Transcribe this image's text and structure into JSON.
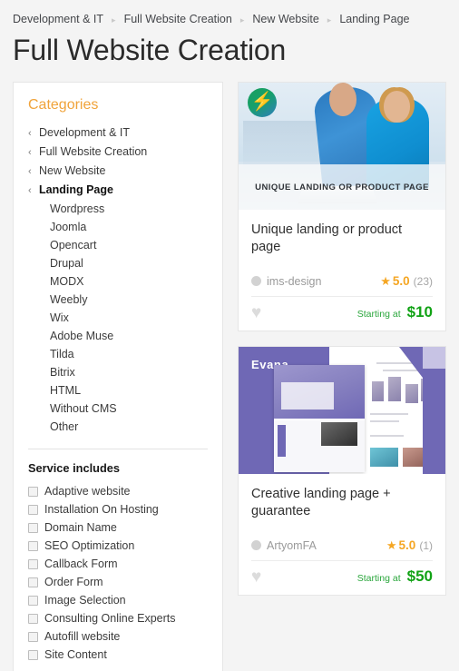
{
  "breadcrumb": {
    "separator": "▸",
    "items": [
      {
        "label": "Development & IT"
      },
      {
        "label": "Full Website Creation"
      },
      {
        "label": "New Website"
      },
      {
        "label": "Landing Page"
      }
    ]
  },
  "page": {
    "title": "Full Website Creation"
  },
  "sidebar": {
    "categories_heading": "Categories",
    "chevron": "‹",
    "tree": [
      {
        "label": "Development & IT",
        "active": false
      },
      {
        "label": "Full Website Creation",
        "active": false
      },
      {
        "label": "New Website",
        "active": false
      },
      {
        "label": "Landing Page",
        "active": true
      }
    ],
    "subcategories": [
      {
        "label": "Wordpress"
      },
      {
        "label": "Joomla"
      },
      {
        "label": "Opencart"
      },
      {
        "label": "Drupal"
      },
      {
        "label": "MODX"
      },
      {
        "label": "Weebly"
      },
      {
        "label": "Wix"
      },
      {
        "label": "Adobe Muse"
      },
      {
        "label": "Tilda"
      },
      {
        "label": "Bitrix"
      },
      {
        "label": "HTML"
      },
      {
        "label": "Without CMS"
      },
      {
        "label": "Other"
      }
    ],
    "service_includes_heading": "Service includes",
    "service_includes": [
      {
        "label": "Adaptive website",
        "checked": false
      },
      {
        "label": "Installation On Hosting",
        "checked": false
      },
      {
        "label": "Domain Name",
        "checked": false
      },
      {
        "label": "SEO Optimization",
        "checked": false
      },
      {
        "label": "Callback Form",
        "checked": false
      },
      {
        "label": "Order Form",
        "checked": false
      },
      {
        "label": "Image Selection",
        "checked": false
      },
      {
        "label": "Consulting Online Experts",
        "checked": false
      },
      {
        "label": "Autofill website",
        "checked": false
      },
      {
        "label": "Site Content",
        "checked": false
      }
    ]
  },
  "results": {
    "cards": [
      {
        "banner_text": "UNIQUE LANDING OR PRODUCT PAGE",
        "logo_icon": "lightning-bolt-icon",
        "logo_glyph": "⚡",
        "title": "Unique landing or product page",
        "seller": "ims-design",
        "rating_star": "★",
        "rating": "5.0",
        "rating_count": "(23)",
        "favorite_glyph": "♥",
        "starting_label": "Starting at",
        "price": "$10"
      },
      {
        "brand": "Evana",
        "title": "Creative landing page + guarantee",
        "seller": "ArtyomFA",
        "rating_star": "★",
        "rating": "5.0",
        "rating_count": "(1)",
        "favorite_glyph": "♥",
        "starting_label": "Starting at",
        "price": "$50"
      }
    ]
  },
  "colors": {
    "accent_orange": "#f0a33a",
    "rating_gold": "#f5a623",
    "price_green": "#11a215",
    "card_purple": "#6f68b5",
    "page_bg": "#f4f4f4"
  }
}
